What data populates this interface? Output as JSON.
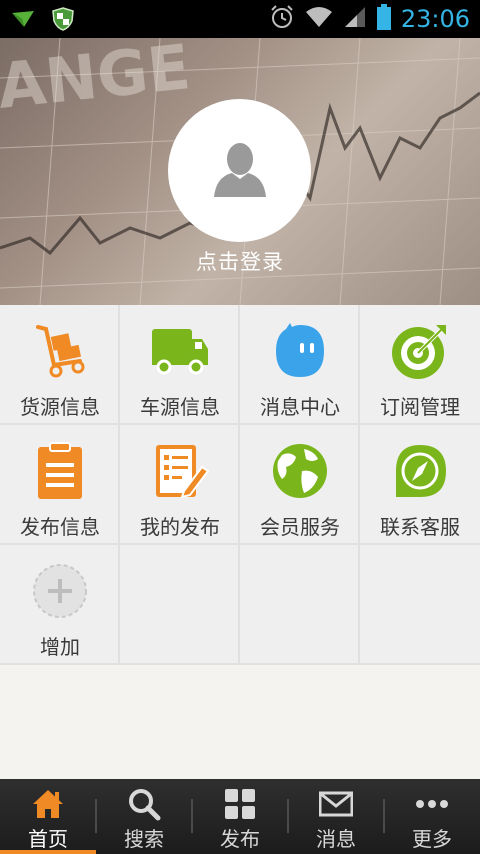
{
  "status_bar": {
    "time": "23:06"
  },
  "header": {
    "login_text": "点击登录"
  },
  "grid": [
    {
      "label": "货源信息",
      "icon": "cart-icon"
    },
    {
      "label": "车源信息",
      "icon": "truck-icon"
    },
    {
      "label": "消息中心",
      "icon": "chat-bubble-icon"
    },
    {
      "label": "订阅管理",
      "icon": "target-icon"
    },
    {
      "label": "发布信息",
      "icon": "clipboard-icon"
    },
    {
      "label": "我的发布",
      "icon": "edit-list-icon"
    },
    {
      "label": "会员服务",
      "icon": "globe-icon"
    },
    {
      "label": "联系客服",
      "icon": "compass-icon"
    },
    {
      "label": "增加",
      "icon": "add-icon"
    }
  ],
  "tabs": [
    {
      "label": "首页",
      "icon": "home-icon",
      "active": true
    },
    {
      "label": "搜索",
      "icon": "search-icon"
    },
    {
      "label": "发布",
      "icon": "grid-icon"
    },
    {
      "label": "消息",
      "icon": "mail-icon"
    },
    {
      "label": "更多",
      "icon": "more-icon"
    }
  ],
  "colors": {
    "accent": "#f08a24",
    "status_time": "#35b5e5",
    "green": "#7bb51c",
    "blue": "#3aa3ea",
    "orange": "#f08a24"
  }
}
